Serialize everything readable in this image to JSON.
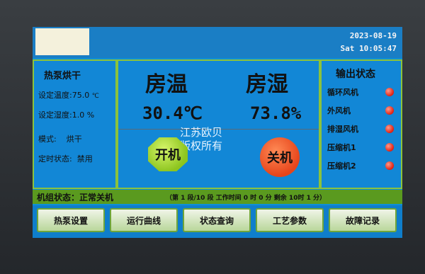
{
  "header": {
    "date": "2023-08-19",
    "time": "Sat 10:05:47"
  },
  "left_panel": {
    "title": "热泵烘干",
    "set_temp_label": "设定温度:",
    "set_temp_value": "75.0",
    "set_temp_unit": "℃",
    "set_humidity_label": "设定湿度:",
    "set_humidity_value": "1.0",
    "set_humidity_unit": "%",
    "mode_label": "模式:",
    "mode_value": "烘干",
    "timer_label": "定时状态:",
    "timer_value": "禁用"
  },
  "center_panel": {
    "room_temp_label": "房温",
    "room_humidity_label": "房湿",
    "room_temp_value": "30.4℃",
    "room_humidity_value": "73.8%",
    "watermark_line1": "江苏欧贝",
    "watermark_line2": "版权所有",
    "on_button": "开机",
    "off_button": "关机"
  },
  "right_panel": {
    "title": "输出状态",
    "items": [
      {
        "label": "循环风机",
        "state": "off"
      },
      {
        "label": "外风机",
        "state": "off"
      },
      {
        "label": "排湿风机",
        "state": "off"
      },
      {
        "label": "压缩机1",
        "state": "off"
      },
      {
        "label": "压缩机2",
        "state": "off"
      }
    ],
    "led_color": "#e21f10"
  },
  "status_bar": {
    "unit_status": "机组状态：正常关机",
    "detail": "（第 1 段/10 段 工作时间 0 时 0 分 剩余 10时 1 分）"
  },
  "nav": {
    "buttons": [
      "热泵设置",
      "运行曲线",
      "状态查询",
      "工艺参数",
      "故障记录"
    ]
  },
  "colors": {
    "panel_bg": "#1287d6",
    "panel_border": "#8bc23d",
    "status_green": "#5a9a1f"
  }
}
